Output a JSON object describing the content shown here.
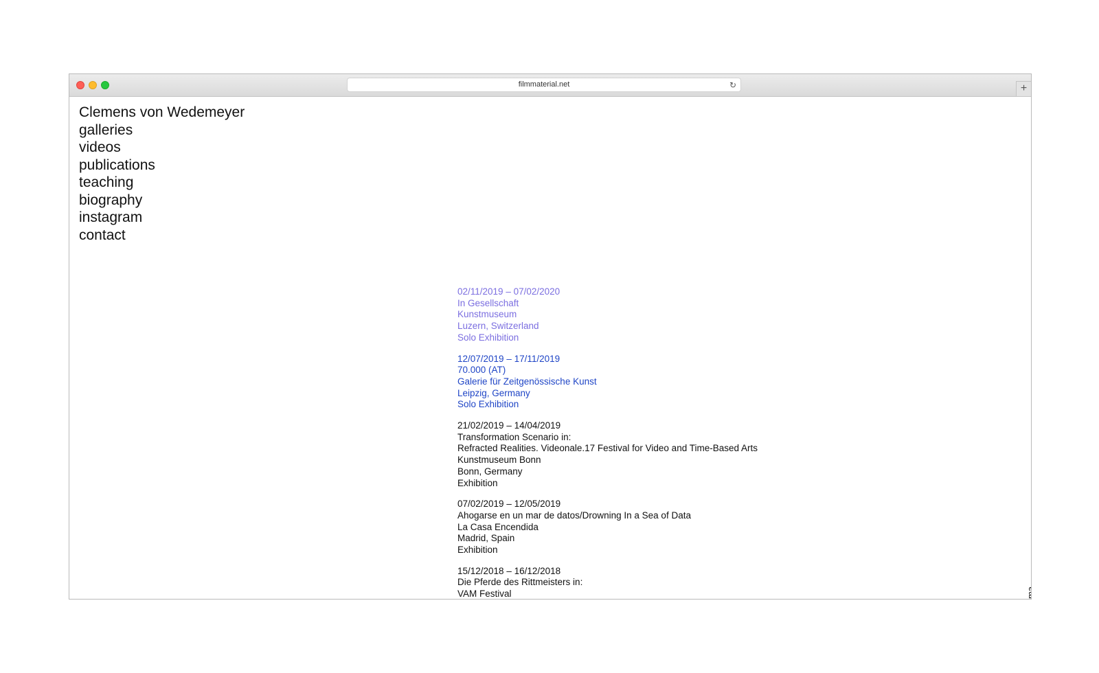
{
  "browser": {
    "url": "filmmaterial.net"
  },
  "nav": {
    "items": [
      "Clemens von Wedemeyer",
      "galleries",
      "videos",
      "publications",
      "teaching",
      "biography",
      "instagram",
      "contact"
    ]
  },
  "entries": [
    {
      "color": "#7b6ee0",
      "dates": "02/11/2019 – 07/02/2020",
      "lines": [
        "In Gesellschaft",
        "Kunstmuseum",
        "Luzern, Switzerland",
        "Solo Exhibition"
      ]
    },
    {
      "color": "#1f45c6",
      "dates": "12/07/2019 – 17/11/2019",
      "lines": [
        "70.000 (AT)",
        "Galerie für Zeitgenössische Kunst",
        "Leipzig, Germany",
        "Solo Exhibition"
      ]
    },
    {
      "color": "#111111",
      "dates": "21/02/2019 – 14/04/2019",
      "lines": [
        "Transformation Scenario in:",
        "Refracted Realities. Videonale.17 Festival for Video and Time-Based Arts",
        "Kunstmuseum Bonn",
        "Bonn, Germany",
        "Exhibition"
      ]
    },
    {
      "color": "#111111",
      "dates": "07/02/2019 – 12/05/2019",
      "lines": [
        "Ahogarse en un mar de datos/Drowning In a Sea of Data",
        "La Casa Encendida",
        "Madrid, Spain",
        "Exhibition"
      ]
    },
    {
      "color": "#111111",
      "dates": "15/12/2018 – 16/12/2018",
      "lines": [
        "Die Pferde des Rittmeisters in:",
        "VAM Festival"
      ]
    }
  ],
  "side_link": "imprint / cinema"
}
